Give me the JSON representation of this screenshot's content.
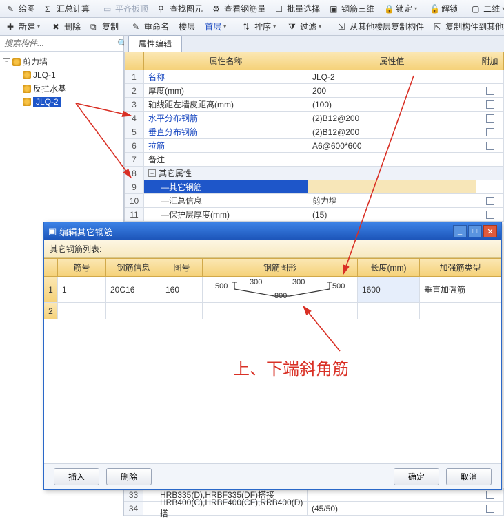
{
  "toolbar1": {
    "draw": "绘图",
    "sumcalc": "汇总计算",
    "flattop": "平齐板顶",
    "findent": "查找图元",
    "viewrebar": "查看钢筋量",
    "batchsel": "批量选择",
    "rebar3d": "钢筋三维",
    "lock": "锁定",
    "unlock": "解锁",
    "view2d": "二维"
  },
  "toolbar2": {
    "new_": "新建",
    "delete_": "删除",
    "copy_": "复制",
    "rename": "重命名",
    "floor": "楼层",
    "firstfloor": "首层",
    "sort": "排序",
    "filter": "过滤",
    "copyfrom": "从其他楼层复制构件",
    "copyto": "复制构件到其他楼层"
  },
  "search": {
    "placeholder": "搜索构件..."
  },
  "tree": {
    "root": "剪力墙",
    "items": [
      "JLQ-1",
      "反拦水基",
      "JLQ-2"
    ]
  },
  "tabs": {
    "propedit": "属性编辑"
  },
  "prop": {
    "head": {
      "name": "属性名称",
      "value": "属性值",
      "extra": "附加"
    },
    "rows": [
      {
        "n": "1",
        "name": "名称",
        "val": "JLQ-2",
        "blue": true
      },
      {
        "n": "2",
        "name": "厚度(mm)",
        "val": "200"
      },
      {
        "n": "3",
        "name": "轴线距左墙皮距离(mm)",
        "val": "(100)"
      },
      {
        "n": "4",
        "name": "水平分布钢筋",
        "val": "(2)B12@200",
        "blue": true
      },
      {
        "n": "5",
        "name": "垂直分布钢筋",
        "val": "(2)B12@200",
        "blue": true
      },
      {
        "n": "6",
        "name": "拉筋",
        "val": "A6@600*600",
        "blue": true
      },
      {
        "n": "7",
        "name": "备注",
        "val": ""
      }
    ],
    "group": {
      "n": "8",
      "name": "其它属性"
    },
    "sel": {
      "n": "9",
      "name": "其它钢筋"
    },
    "rows2": [
      {
        "n": "10",
        "name": "汇总信息",
        "val": "剪力墙"
      },
      {
        "n": "11",
        "name": "保护层厚度(mm)",
        "val": "(15)"
      }
    ],
    "bottomrow1": {
      "n": "33",
      "name": "HRB335(D),HRBF335(DF)搭接",
      "val": ""
    },
    "bottomrow2": {
      "n": "34",
      "name": "HRB400(C),HRBF400(CF),RRB400(D)搭",
      "val": "(45/50)"
    }
  },
  "dialog": {
    "title": "编辑其它钢筋",
    "subtitle": "其它钢筋列表:",
    "head": {
      "a": "筋号",
      "b": "钢筋信息",
      "c": "图号",
      "d": "钢筋图形",
      "e": "长度(mm)",
      "f": "加强筋类型"
    },
    "row": {
      "n": "1",
      "a": "1",
      "b": "20C16",
      "c": "160",
      "e": "1600",
      "f": "垂直加强筋"
    },
    "shape": {
      "l": "500",
      "t1": "300",
      "t2": "300",
      "r": "500",
      "bot": "800"
    },
    "row2n": "2",
    "btn_insert": "插入",
    "btn_delete": "删除",
    "btn_ok": "确定",
    "btn_cancel": "取消"
  },
  "annotation": "上、下端斜角筋"
}
